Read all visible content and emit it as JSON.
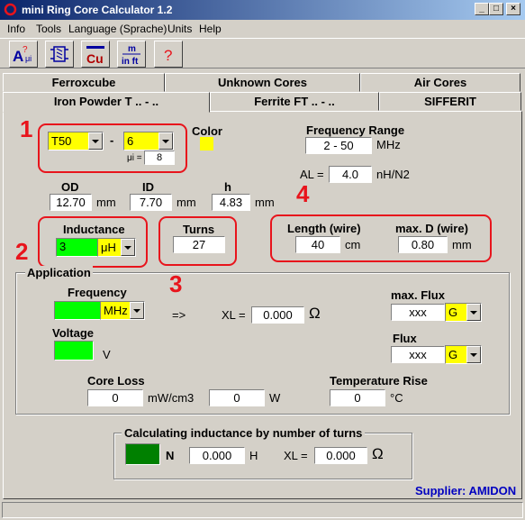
{
  "window": {
    "title": "mini Ring Core Calculator 1.2",
    "minimize": "_",
    "maximize": "□",
    "close": "×"
  },
  "menu": [
    "Info",
    "Tools",
    "Language (Sprache)",
    "Units",
    "Help"
  ],
  "toolbar": {
    "buttons": [
      {
        "icon": "inductance-calc-icon",
        "text": "A ? μi"
      },
      {
        "icon": "coil-icon",
        "text": ""
      },
      {
        "icon": "copper-icon",
        "text": "Cu"
      },
      {
        "icon": "metric-inch-icon",
        "text": "m in ft"
      },
      {
        "icon": "help-icon",
        "text": "?"
      }
    ]
  },
  "tabs": {
    "row1": [
      "Ferroxcube",
      "Unknown Cores",
      "Air Cores"
    ],
    "row2": [
      "Iron Powder T .. - ..",
      "Ferrite FT .. - ..",
      "SIFFERIT"
    ],
    "active": "Iron Powder T .. - .."
  },
  "core": {
    "size": "T50",
    "dash": "-",
    "material": "6",
    "mui_label": "μi =",
    "mui_value": "8",
    "color_label": "Color",
    "color": "#ffff00"
  },
  "frequency_range": {
    "label": "Frequency Range",
    "value": "2 - 50",
    "unit": "MHz"
  },
  "al": {
    "label": "AL =",
    "value": "4.0",
    "unit": "nH/N2"
  },
  "dimensions": {
    "od": {
      "label": "OD",
      "value": "12.70",
      "unit": "mm"
    },
    "id": {
      "label": "ID",
      "value": "7.70",
      "unit": "mm"
    },
    "h": {
      "label": "h",
      "value": "4.83",
      "unit": "mm"
    }
  },
  "inductance": {
    "label": "Inductance",
    "value": "3",
    "unit": "μH"
  },
  "turns": {
    "label": "Turns",
    "value": "27"
  },
  "wire": {
    "length_label": "Length (wire)",
    "length_value": "40",
    "length_unit": "cm",
    "maxd_label": "max. D (wire)",
    "maxd_value": "0.80",
    "maxd_unit": "mm"
  },
  "markers": [
    "1",
    "2",
    "3",
    "4"
  ],
  "application": {
    "title": "Application",
    "frequency_label": "Frequency",
    "frequency_unit": "MHz",
    "arrow": "=>",
    "xl_label": "XL =",
    "xl_value": "0.000",
    "ohm": "Ω",
    "voltage_label": "Voltage",
    "voltage_unit": "V",
    "maxflux_label": "max. Flux",
    "maxflux_value": "xxx",
    "maxflux_unit": "G",
    "flux_label": "Flux",
    "flux_value": "xxx",
    "flux_unit": "G",
    "coreloss_label": "Core Loss",
    "coreloss_value": "0",
    "coreloss_unit": "mW/cm3",
    "coreloss_w_value": "0",
    "coreloss_w_unit": "W",
    "temprise_label": "Temperature Rise",
    "temprise_value": "0",
    "temprise_unit": "°C"
  },
  "calc": {
    "title": "Calculating inductance by number of turns",
    "n_label": "N",
    "h_value": "0.000",
    "h_unit": "H",
    "xl_label": "XL =",
    "xl_value": "0.000",
    "ohm": "Ω"
  },
  "supplier": "Supplier: AMIDON",
  "colors": {
    "red_marker": "#e8141c",
    "green": "#00ff00",
    "dark_green": "#008000",
    "supplier_blue": "#0000c0"
  }
}
